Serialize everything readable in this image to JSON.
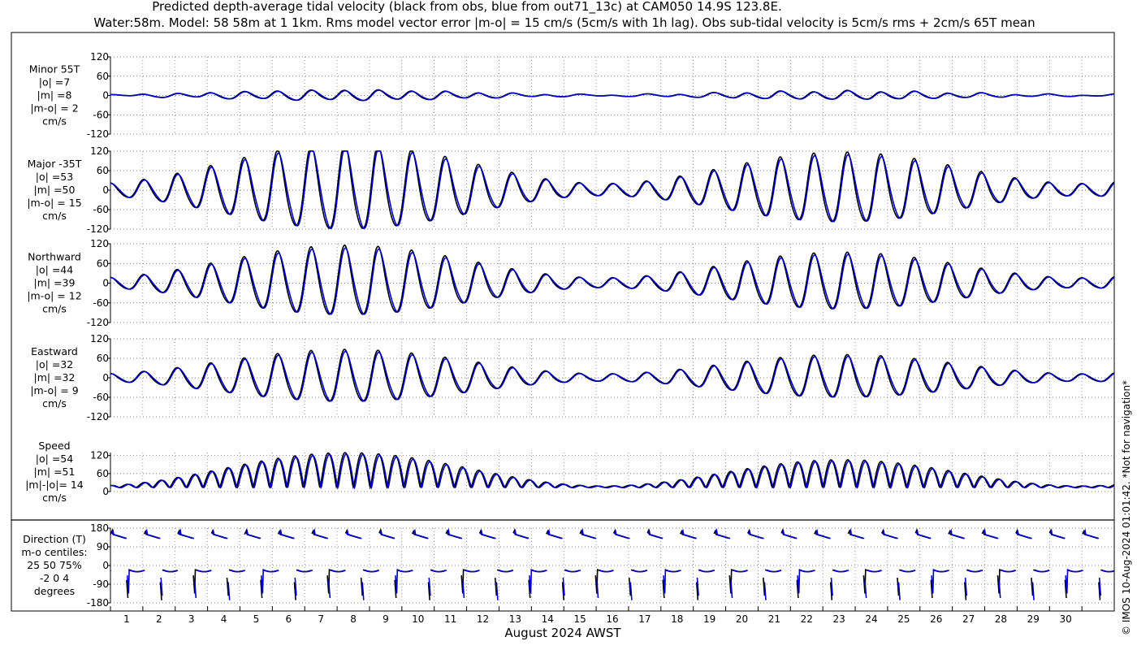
{
  "title_line1": "Predicted depth-average tidal velocity (black from obs, blue from out71_13c) at CAM050 14.9S 123.8E.",
  "title_line2": "Water:58m. Model: 58 58m at 1 1km. Rms model vector error |m-o| = 15 cm/s (5cm/s with 1h lag). Obs sub-tidal velocity is 5cm/s rms + 2cm/s 65T mean",
  "watermark": "© IMOS 10-Aug-2024 01:01:42. *Not for navigation*",
  "xlabel": "August 2024 AWST",
  "x_ticks": [
    "1",
    "2",
    "3",
    "4",
    "5",
    "6",
    "7",
    "8",
    "9",
    "10",
    "11",
    "12",
    "13",
    "14",
    "15",
    "16",
    "17",
    "18",
    "19",
    "20",
    "21",
    "22",
    "23",
    "24",
    "25",
    "26",
    "27",
    "28",
    "29",
    "30"
  ],
  "colors": {
    "obs": "#000000",
    "model": "#0000cc",
    "grid": "#555555"
  },
  "chart_data": [
    {
      "type": "line",
      "panel": "minor",
      "label_lines": [
        "Minor 55T",
        "|o| =7",
        "|m| =8",
        "|m-o| = 2",
        "cm/s"
      ],
      "yticks": [
        "120",
        "60",
        "0",
        "-60",
        "-120"
      ],
      "ylim": [
        -120,
        120
      ],
      "series": [
        {
          "name": "obs",
          "mean_amp": 7
        },
        {
          "name": "model",
          "mean_amp": 8
        }
      ]
    },
    {
      "type": "line",
      "panel": "major",
      "label_lines": [
        "Major -35T",
        "|o| =53",
        "|m| =50",
        "|m-o| = 15",
        "cm/s"
      ],
      "yticks": [
        "120",
        "60",
        "0",
        "-60",
        "-120"
      ],
      "ylim": [
        -120,
        120
      ],
      "series": [
        {
          "name": "obs",
          "mean_amp": 53
        },
        {
          "name": "model",
          "mean_amp": 50
        }
      ]
    },
    {
      "type": "line",
      "panel": "north",
      "label_lines": [
        "Northward",
        "|o| =44",
        "|m| =39",
        "|m-o| = 12",
        "cm/s"
      ],
      "yticks": [
        "120",
        "60",
        "0",
        "-60",
        "-120"
      ],
      "ylim": [
        -120,
        120
      ],
      "series": [
        {
          "name": "obs",
          "mean_amp": 44
        },
        {
          "name": "model",
          "mean_amp": 39
        }
      ]
    },
    {
      "type": "line",
      "panel": "east",
      "label_lines": [
        "Eastward",
        "|o| =32",
        "|m| =32",
        "|m-o| = 9",
        "cm/s"
      ],
      "yticks": [
        "120",
        "60",
        "0",
        "-60",
        "-120"
      ],
      "ylim": [
        -120,
        120
      ],
      "series": [
        {
          "name": "obs",
          "mean_amp": 32
        },
        {
          "name": "model",
          "mean_amp": 32
        }
      ]
    },
    {
      "type": "line",
      "panel": "speed",
      "label_lines": [
        "Speed",
        "|o| =54",
        "|m| =51",
        "|m|-|o|= 14",
        "cm/s"
      ],
      "yticks": [
        "120",
        "60",
        "0"
      ],
      "ylim": [
        0,
        130
      ],
      "series": [
        {
          "name": "obs",
          "mean_amp": 54
        },
        {
          "name": "model",
          "mean_amp": 51
        }
      ]
    },
    {
      "type": "line",
      "panel": "direction",
      "label_lines": [
        "Direction (T)",
        "m-o centiles:",
        "25  50  75%",
        "-2  0  4",
        "degrees"
      ],
      "yticks": [
        "180",
        "90",
        "0",
        "-90",
        "-180"
      ],
      "ylim": [
        -180,
        180
      ],
      "series": [
        {
          "name": "obs"
        },
        {
          "name": "model"
        }
      ]
    }
  ]
}
